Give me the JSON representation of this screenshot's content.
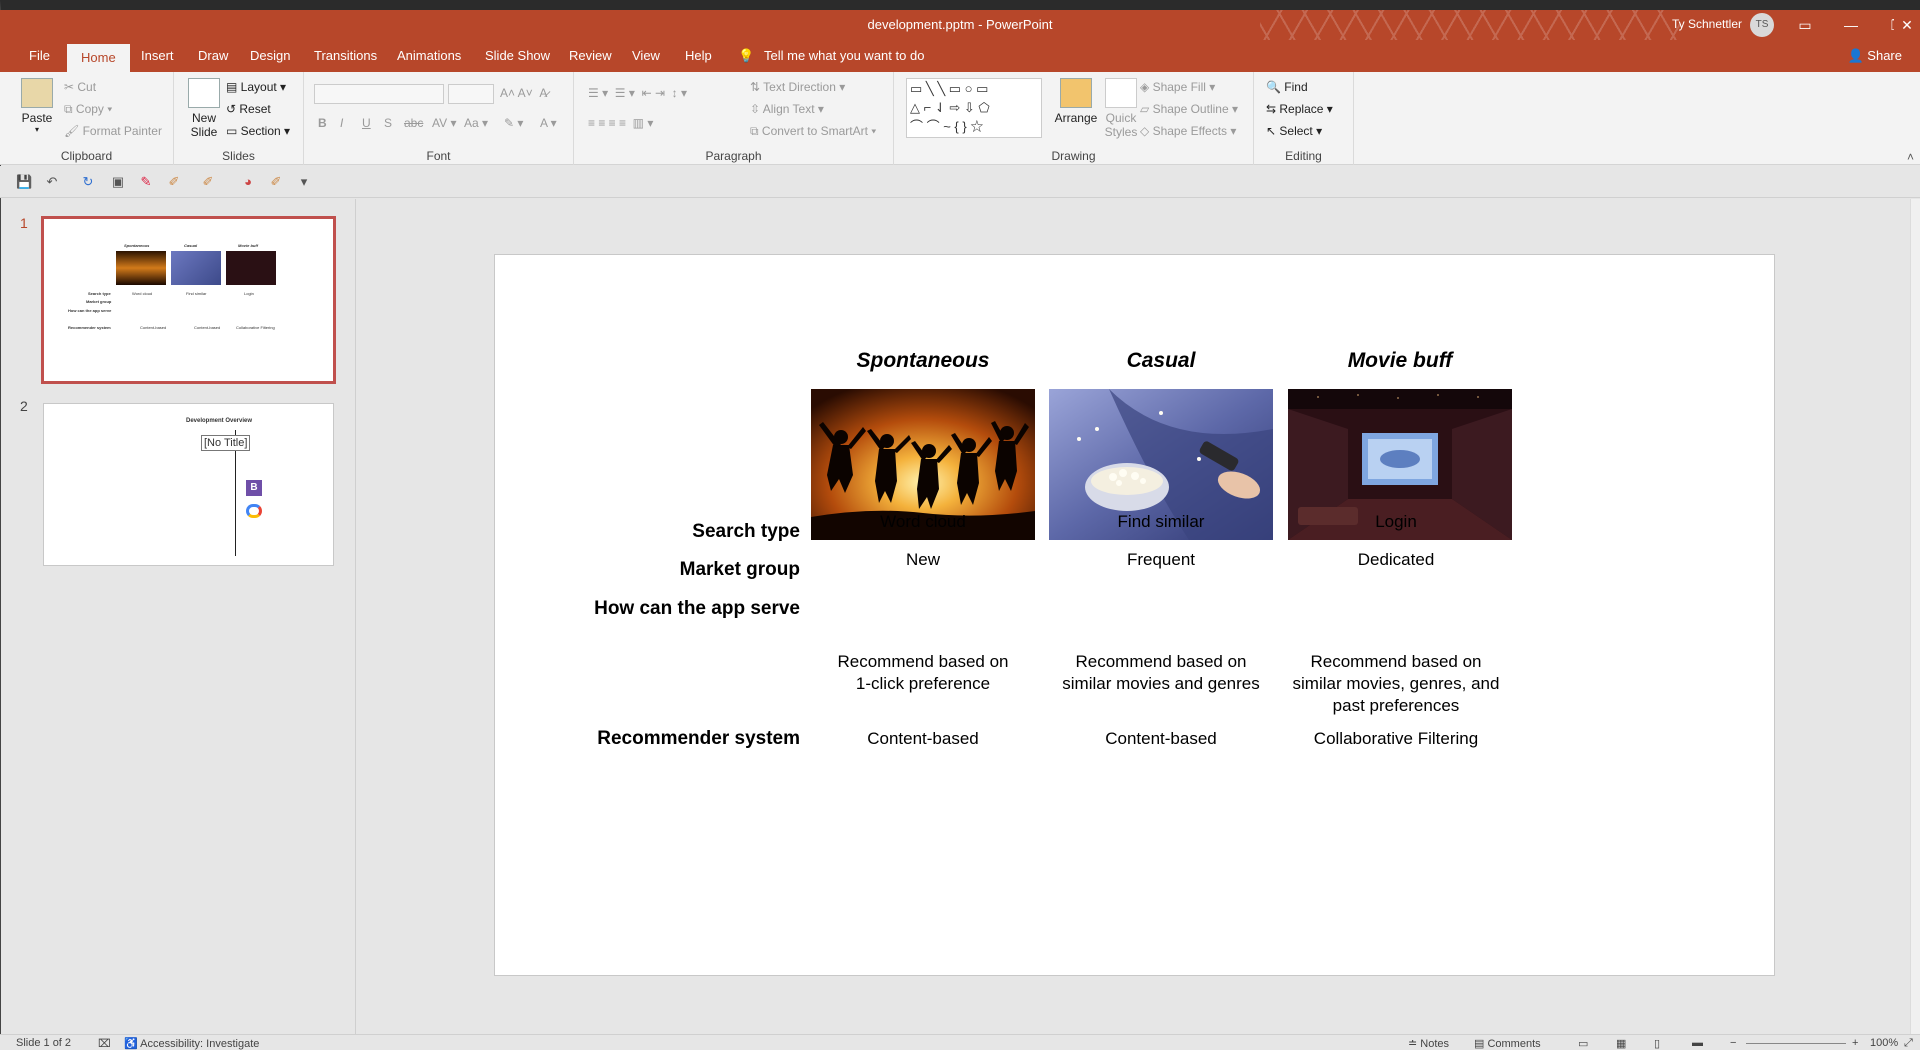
{
  "window": {
    "title": "development.pptm  -  PowerPoint",
    "user": "Ty Schnettler",
    "user_initials": "TS"
  },
  "tabs": [
    "File",
    "Home",
    "Insert",
    "Draw",
    "Design",
    "Transitions",
    "Animations",
    "Slide Show",
    "Review",
    "View",
    "Help"
  ],
  "active_tab": "Home",
  "tell_me": "Tell me what you want to do",
  "share": "Share",
  "ribbon": {
    "clipboard": {
      "paste": "Paste",
      "cut": "Cut",
      "copy": "Copy",
      "format_painter": "Format Painter",
      "label": "Clipboard"
    },
    "slides": {
      "new_slide_1": "New",
      "new_slide_2": "Slide",
      "layout": "Layout",
      "reset": "Reset",
      "section": "Section",
      "label": "Slides"
    },
    "font": {
      "label": "Font"
    },
    "paragraph": {
      "text_direction": "Text Direction",
      "align_text": "Align Text",
      "convert_smartart": "Convert to SmartArt",
      "label": "Paragraph"
    },
    "drawing": {
      "arrange": "Arrange",
      "quick_styles_1": "Quick",
      "quick_styles_2": "Styles",
      "shape_fill": "Shape Fill",
      "shape_outline": "Shape Outline",
      "shape_effects": "Shape Effects",
      "label": "Drawing"
    },
    "editing": {
      "find": "Find",
      "replace": "Replace",
      "select": "Select",
      "label": "Editing"
    }
  },
  "thumbnails": [
    {
      "number": "1",
      "selected": true
    },
    {
      "number": "2",
      "selected": false,
      "title": "Development Overview",
      "tooltip": "[No Title]"
    }
  ],
  "slide": {
    "columns": [
      "Spontaneous",
      "Casual",
      "Movie buff"
    ],
    "rows": [
      {
        "label": "Search type",
        "values": [
          "Word cloud",
          "Find similar",
          "Login"
        ]
      },
      {
        "label": "Market group",
        "values": [
          "New",
          "Frequent",
          "Dedicated"
        ]
      },
      {
        "label": "How can the app serve",
        "values": [
          "Recommend based on 1-click preference",
          "Recommend based on similar movies and genres",
          "Recommend based on similar movies, genres, and past preferences"
        ]
      },
      {
        "label": "Recommender system",
        "values": [
          "Content-based",
          "Content-based",
          "Collaborative Filtering"
        ]
      }
    ]
  },
  "status": {
    "slide_of": "Slide 1 of 2",
    "accessibility": "Accessibility: Investigate",
    "notes": "Notes",
    "comments": "Comments",
    "zoom": "100%"
  },
  "colors": {
    "accent": "#b7472a",
    "selected_border": "#c0504d"
  }
}
